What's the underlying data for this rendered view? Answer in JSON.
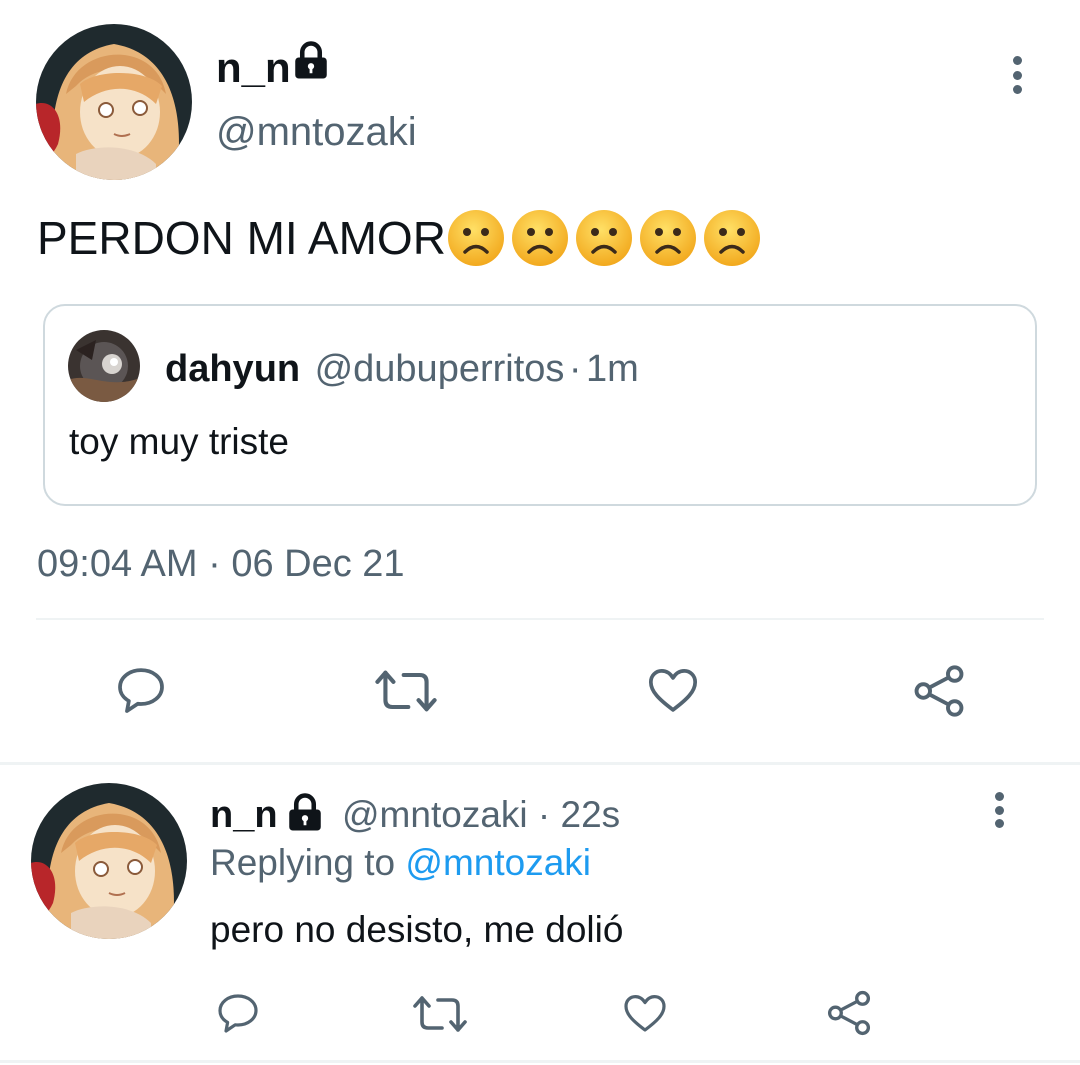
{
  "main_tweet": {
    "author": {
      "display_name": "n_n",
      "handle": "@mntozaki",
      "protected": true
    },
    "text": "PERDON MI AMOR",
    "emojis": [
      "frowning-face",
      "frowning-face",
      "frowning-face",
      "frowning-face",
      "frowning-face"
    ],
    "quoted_tweet": {
      "display_name": "dahyun",
      "handle": "@dubuperritos",
      "separator": "·",
      "time": "1m",
      "text": "toy muy triste"
    },
    "timestamp": {
      "time": "09:04 AM",
      "separator": "·",
      "date": "06 Dec 21"
    },
    "actions": [
      "reply-icon",
      "retweet-icon",
      "like-icon",
      "share-icon"
    ]
  },
  "reply_tweet": {
    "author": {
      "display_name": "n_n",
      "handle": "@mntozaki",
      "protected": true
    },
    "separator": "·",
    "time": "22s",
    "replying_prefix": "Replying to",
    "replying_to": "@mntozaki",
    "text": "pero no desisto, me dolió",
    "actions": [
      "reply-icon",
      "retweet-icon",
      "like-icon",
      "share-icon"
    ]
  },
  "colors": {
    "text_primary": "#0f1419",
    "text_secondary": "#536471",
    "link": "#1d9bf0",
    "border": "#cfd9de",
    "divider": "#eff3f4"
  }
}
